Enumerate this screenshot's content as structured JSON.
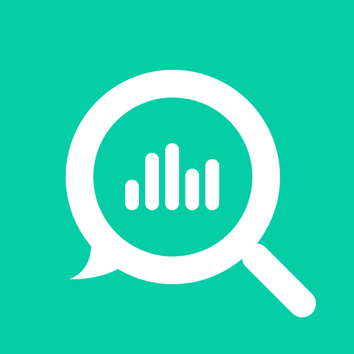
{
  "icon": {
    "name": "search-analytics-icon",
    "background_color": "#05CDA6",
    "foreground_color": "#FFFFFF"
  }
}
